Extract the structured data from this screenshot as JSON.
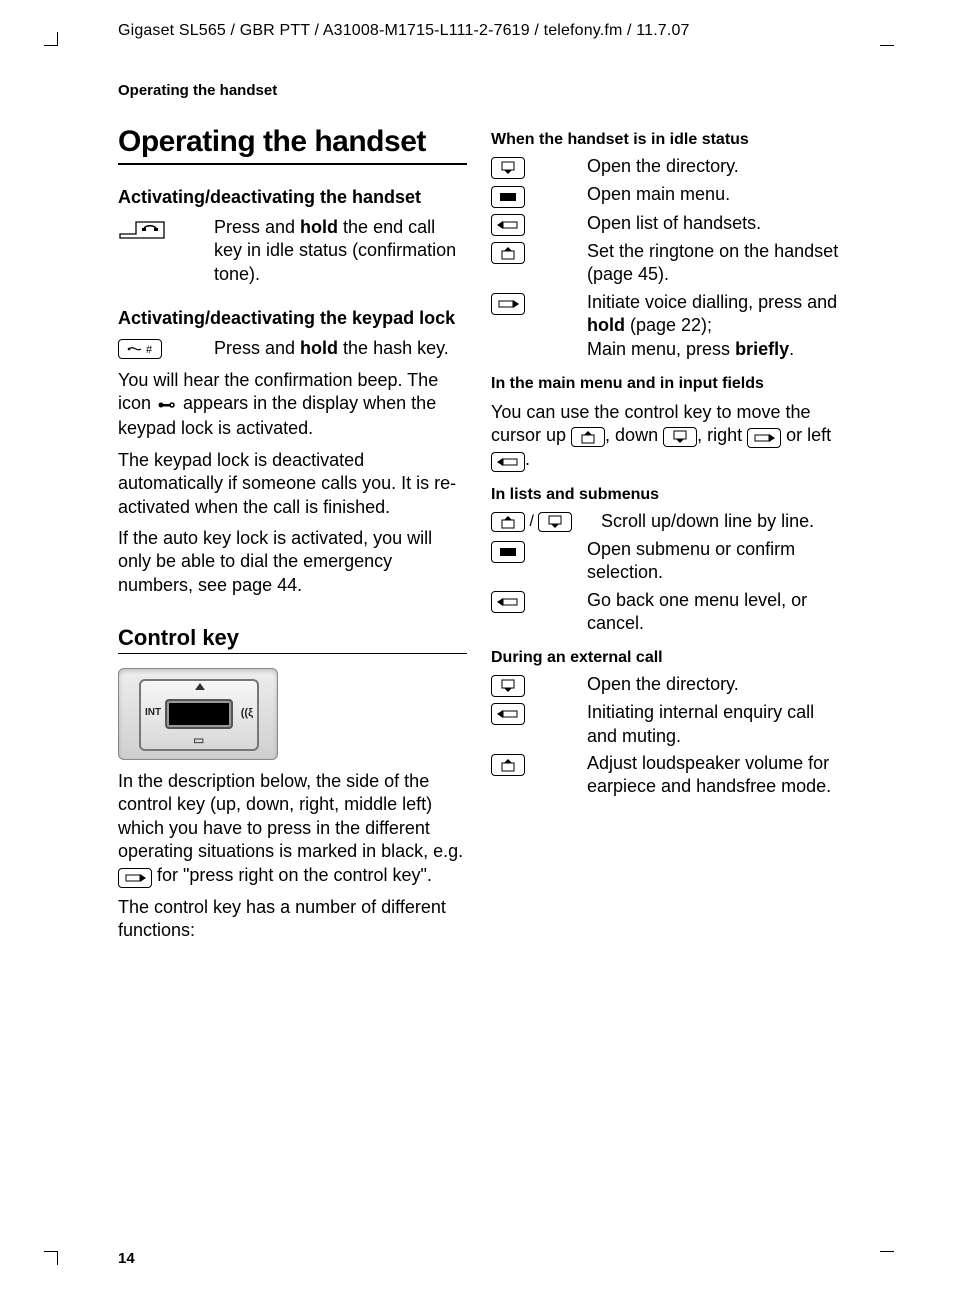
{
  "docHeader": "Gigaset SL565 / GBR PTT / A31008-M1715-L111-2-7619 / telefony.fm / 11.7.07",
  "runningHead": "Operating the handset",
  "pageNumber": "14",
  "left": {
    "h1": "Operating the handset",
    "sec1": {
      "h3": "Activating/deactivating the handset",
      "item_desc_pre": "Press and ",
      "item_desc_bold": "hold",
      "item_desc_post": " the end call key in idle status (confirmation tone)."
    },
    "sec2": {
      "h3": "Activating/deactivating the keypad lock",
      "item_desc_pre": "Press and ",
      "item_desc_bold": "hold",
      "item_desc_post": " the hash key.",
      "p1_pre": "You will hear the confirmation beep. The icon ",
      "p1_post": " appears in the display when the keypad lock is activated.",
      "p2": "The keypad lock is deactivated automatically if someone calls you. It is re-activated when the call is finished.",
      "p3": "If the auto key lock is activated, you will only be able to dial the emergency numbers, see page 44."
    },
    "sec3": {
      "h2": "Control key",
      "p1_pre": "In the description below, the side of the control key (up, down, right, middle left) which you have to press in the different operating situations is marked in black, e.g. ",
      "p1_post": " for \"press right on the control key\".",
      "p2": "The control key has a number of different functions:"
    }
  },
  "right": {
    "idle": {
      "h4": "When the handset is in idle status",
      "r1": "Open the directory.",
      "r2": "Open main menu.",
      "r3": "Open list of handsets.",
      "r4": "Set the ringtone on the handset (page 45).",
      "r5_pre": "Initiate voice dialling, press and ",
      "r5_bold1": "hold",
      "r5_mid": " (page 22);\nMain menu, press ",
      "r5_bold2": "briefly",
      "r5_post": "."
    },
    "mainmenu": {
      "h4": "In the main menu and in input fields",
      "p_pre": "You can use the control key to move the cursor up ",
      "p_mid1": ", down ",
      "p_mid2": ", right ",
      "p_mid3": " or left ",
      "p_post": "."
    },
    "lists": {
      "h4": "In lists and submenus",
      "r1": "Scroll up/down line by line.",
      "r2": "Open submenu or confirm selection.",
      "r3": "Go back one menu level, or cancel."
    },
    "call": {
      "h4": "During an external call",
      "r1": "Open the directory.",
      "r2": "Initiating internal enquiry call and muting.",
      "r3": "Adjust loudspeaker volume for earpiece and handsfree mode."
    }
  }
}
